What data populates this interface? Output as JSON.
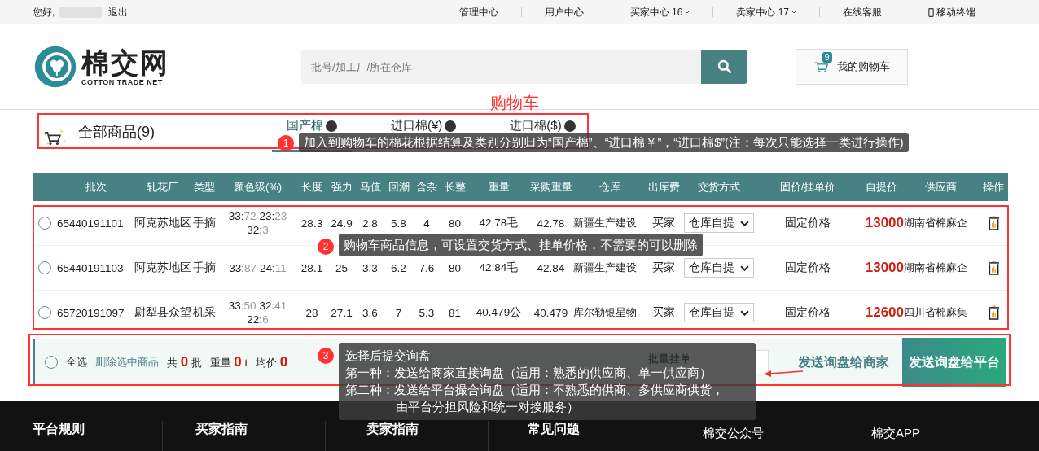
{
  "top_bar": {
    "greeting": "您好,",
    "logout": "退出",
    "links": [
      {
        "label": "管理中心",
        "dropdown": false,
        "phone": false
      },
      {
        "label": "用户中心",
        "dropdown": false,
        "phone": false
      },
      {
        "label": "买家中心 16",
        "dropdown": true,
        "phone": false
      },
      {
        "label": "卖家中心 17",
        "dropdown": true,
        "phone": false
      },
      {
        "label": "在线客服",
        "dropdown": false,
        "phone": false
      },
      {
        "label": "移动终端",
        "dropdown": false,
        "phone": true
      }
    ]
  },
  "header": {
    "logo_name": "棉交网",
    "logo_sub": "COTTON TRADE NET",
    "search": {
      "placeholder": "批号/加工厂/所在仓库"
    },
    "page_label": "购物车",
    "cart": {
      "count": "9",
      "label": "我的购物车"
    }
  },
  "tabs": {
    "all": "全部商品(9)",
    "items": [
      {
        "label": "国产棉",
        "selected": true
      },
      {
        "label": "进口棉(¥)",
        "selected": false
      },
      {
        "label": "进口棉($)",
        "selected": false
      }
    ]
  },
  "table": {
    "columns": [
      "批次",
      "轧花厂",
      "类型",
      "颜色级(%)",
      "长度",
      "强力",
      "马值",
      "回潮",
      "含杂",
      "长整",
      "重量",
      "采购重量",
      "仓库",
      "出库费",
      "交货方式",
      "固价/挂单价",
      "自提价",
      "供应商",
      "操作"
    ],
    "rows": [
      {
        "selected": false,
        "batch": "65440191101",
        "factory": "阿克苏地区",
        "type": "手摘",
        "grades": [
          {
            "code": "33:",
            "pct": "72"
          },
          {
            "code": "23:",
            "pct": "23"
          },
          {
            "code": "32:",
            "pct": "3"
          }
        ],
        "length": "28.3",
        "strength": "24.9",
        "mic": "2.8",
        "moisture": "5.8",
        "impurity": "4",
        "uniformity": "80",
        "weight": "42.78毛",
        "purchase_weight": "42.78",
        "warehouse": "新疆生产建设",
        "fee": "买家",
        "delivery": "仓库自提",
        "price_type": "固定价格",
        "price": "13000",
        "supplier": "湖南省棉麻企"
      },
      {
        "selected": false,
        "batch": "65440191103",
        "factory": "阿克苏地区",
        "type": "手摘",
        "grades": [
          {
            "code": "33:",
            "pct": "87"
          },
          {
            "code": "24:",
            "pct": "11"
          }
        ],
        "length": "28.1",
        "strength": "25",
        "mic": "3.3",
        "moisture": "6.2",
        "impurity": "7.6",
        "uniformity": "80",
        "weight": "42.84毛",
        "purchase_weight": "42.84",
        "warehouse": "新疆生产建设",
        "fee": "买家",
        "delivery": "仓库自提",
        "price_type": "固定价格",
        "price": "13000",
        "supplier": "湖南省棉麻企"
      },
      {
        "selected": false,
        "batch": "65720191097",
        "factory": "尉犁县众望",
        "type": "机采",
        "grades": [
          {
            "code": "33:",
            "pct": "50"
          },
          {
            "code": "32:",
            "pct": "41"
          },
          {
            "code": "22:",
            "pct": "6"
          }
        ],
        "length": "28",
        "strength": "27.1",
        "mic": "3.6",
        "moisture": "7",
        "impurity": "5.3",
        "uniformity": "81",
        "weight": "40.479公",
        "purchase_weight": "40.479",
        "warehouse": "库尔勒银星物",
        "fee": "买家",
        "delivery": "仓库自提",
        "price_type": "固定价格",
        "price": "12600",
        "supplier": "四川省棉麻集"
      }
    ]
  },
  "bottom_bar": {
    "select_all": {
      "label": "全选",
      "selected": false
    },
    "delete": "删除选中商品",
    "count": {
      "prefix": "共",
      "value": "0",
      "unit": "批"
    },
    "weight": {
      "prefix": "重量",
      "value": "0",
      "unit": "t"
    },
    "avg": {
      "prefix": "均价",
      "value": "0"
    },
    "batch_label": "批量挂单",
    "send_merchant": "发送询盘给商家",
    "send_platform": "发送询盘给平台"
  },
  "footer": {
    "columns": [
      "平台规则",
      "买家指南",
      "卖家指南",
      "常见问题"
    ],
    "qr_titles": [
      "棉交公众号",
      "棉交APP"
    ]
  },
  "annotations": [
    {
      "number": "1",
      "lines": [
        "加入到购物车的棉花根据结算及类别分别归为“国产棉”、“进口棉￥”，“进口棉$”(注：每次只能选择一类进行操作)"
      ]
    },
    {
      "number": "2",
      "lines": [
        "购物车商品信息，可设置交货方式、挂单价格，不需要的可以删除"
      ]
    },
    {
      "number": "3",
      "lines": [
        "选择后提交询盘",
        "第一种：发送给商家直接询盘（适用：熟悉的供应商、单一供应商）",
        "第二种：发送给平台撮合询盘（适用：不熟悉的供商、多供应商供货，",
        "由平台分担风险和统一对接服务）"
      ]
    }
  ]
}
